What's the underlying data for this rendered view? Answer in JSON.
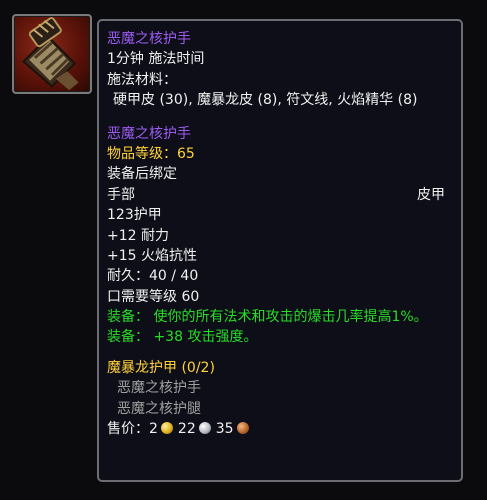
{
  "item": {
    "recipe_title": "恶魔之核护手",
    "cast_time": "1分钟 施法时间",
    "materials_label": "施法材料：",
    "materials": "硬甲皮 (30), 魔暴龙皮 (8), 符文线, 火焰精华 (8)",
    "item_name": "恶魔之核护手",
    "item_level": "物品等级：65",
    "bind": "装备后绑定",
    "slot": "手部",
    "armor_type": "皮甲",
    "armor": "123护甲",
    "stat_stamina": "+12 耐力",
    "stat_fire_res": "+15 火焰抗性",
    "durability": "耐久：40 / 40",
    "required_level": "口需要等级 60",
    "equip_1": "装备：  使你的所有法术和攻击的爆击几率提高1%。",
    "equip_2": "装备：  +38 攻击强度。",
    "set_name": "魔暴龙护甲 (0/2)",
    "set_items": [
      "恶魔之核护手",
      "恶魔之核护腿"
    ],
    "sell_label": "售价：",
    "sell_gold": "2",
    "sell_silver": "22",
    "sell_copper": "35"
  },
  "icon": {
    "name": "gauntlet-icon"
  },
  "colors": {
    "background": "#0d0e17",
    "border": "#6c6e74",
    "title_purple": "#9b5cf0",
    "label_yellow": "#ffd23c",
    "equip_green": "#28dc28",
    "text": "#f0f0f0",
    "set_item_grey": "#a0a0a0"
  }
}
